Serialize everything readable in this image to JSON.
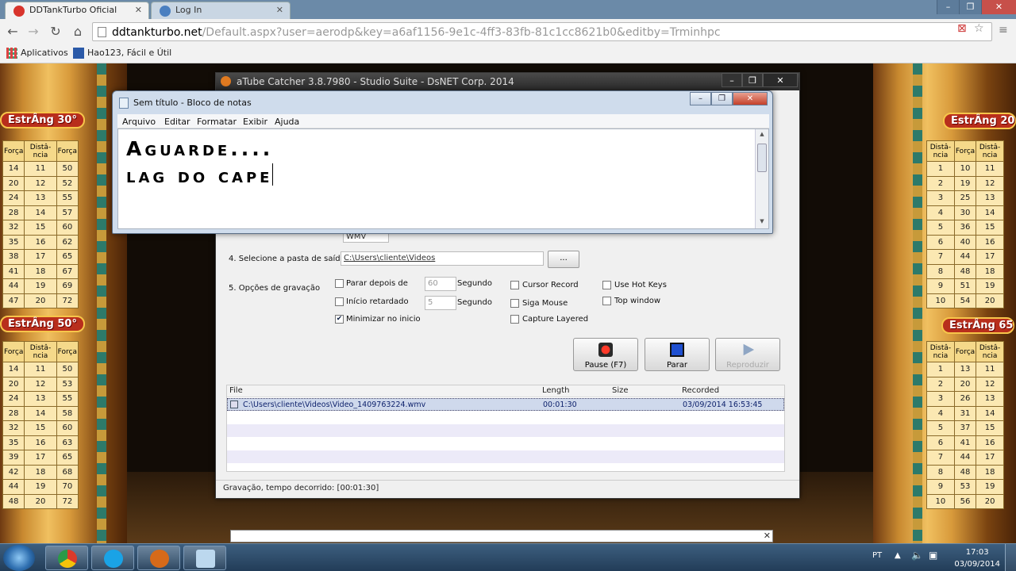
{
  "browser": {
    "tabs": [
      {
        "title": "DDTankTurbo Oficial",
        "active": true
      },
      {
        "title": "Log In",
        "active": false
      }
    ],
    "url_host": "ddtankturbo.net",
    "url_path": "/Default.aspx?user=aerodp&key=a6af1156-9e1c-4ff3-83fb-81c1cc8621b0&editby=Trminhpc",
    "bookmarks": [
      {
        "label": "Aplicativos"
      },
      {
        "label": "Hao123, Fácil e Útil"
      }
    ],
    "icons": {
      "back": "back-arrow-icon",
      "forward": "forward-arrow-icon",
      "reload": "reload-icon",
      "home": "home-icon",
      "star": "star-icon",
      "menu": "hamburger-menu-icon"
    }
  },
  "game": {
    "left_tables": [
      {
        "title": "EstrÂng 30°",
        "headers": [
          "Força",
          "Distâ-ncia",
          "Força"
        ],
        "rows": [
          [
            "14",
            "11",
            "50"
          ],
          [
            "20",
            "12",
            "52"
          ],
          [
            "24",
            "13",
            "55"
          ],
          [
            "28",
            "14",
            "57"
          ],
          [
            "32",
            "15",
            "60"
          ],
          [
            "35",
            "16",
            "62"
          ],
          [
            "38",
            "17",
            "65"
          ],
          [
            "41",
            "18",
            "67"
          ],
          [
            "44",
            "19",
            "69"
          ],
          [
            "47",
            "20",
            "72"
          ]
        ]
      },
      {
        "title": "EstrÂng 50°",
        "headers": [
          "Força",
          "Distâ-ncia",
          "Força"
        ],
        "rows": [
          [
            "14",
            "11",
            "50"
          ],
          [
            "20",
            "12",
            "53"
          ],
          [
            "24",
            "13",
            "55"
          ],
          [
            "28",
            "14",
            "58"
          ],
          [
            "32",
            "15",
            "60"
          ],
          [
            "35",
            "16",
            "63"
          ],
          [
            "39",
            "17",
            "65"
          ],
          [
            "42",
            "18",
            "68"
          ],
          [
            "44",
            "19",
            "70"
          ],
          [
            "48",
            "20",
            "72"
          ]
        ]
      }
    ],
    "right_tables": [
      {
        "title": "EstrÂng 20",
        "headers": [
          "Distâ-ncia",
          "Força",
          "Distâ-ncia"
        ],
        "rows": [
          [
            "1",
            "10",
            "11"
          ],
          [
            "2",
            "19",
            "12"
          ],
          [
            "3",
            "25",
            "13"
          ],
          [
            "4",
            "30",
            "14"
          ],
          [
            "5",
            "36",
            "15"
          ],
          [
            "6",
            "40",
            "16"
          ],
          [
            "7",
            "44",
            "17"
          ],
          [
            "8",
            "48",
            "18"
          ],
          [
            "9",
            "51",
            "19"
          ],
          [
            "10",
            "54",
            "20"
          ]
        ]
      },
      {
        "title": "EstrÂng 65",
        "headers": [
          "Distâ-ncia",
          "Força",
          "Distâ-ncia"
        ],
        "rows": [
          [
            "1",
            "13",
            "11"
          ],
          [
            "2",
            "20",
            "12"
          ],
          [
            "3",
            "26",
            "13"
          ],
          [
            "4",
            "31",
            "14"
          ],
          [
            "5",
            "37",
            "15"
          ],
          [
            "6",
            "41",
            "16"
          ],
          [
            "7",
            "44",
            "17"
          ],
          [
            "8",
            "48",
            "18"
          ],
          [
            "9",
            "53",
            "19"
          ],
          [
            "10",
            "56",
            "20"
          ]
        ]
      }
    ]
  },
  "atube": {
    "title": "aTube Catcher 3.8.7980 - Studio Suite - DsNET Corp. 2014",
    "hidden_format": "WMV",
    "output_folder_label": "4. Selecione a pasta de saída",
    "output_folder_value": "C:\\Users\\cliente\\Videos",
    "browse_label": "...",
    "options_label": "5. Opções de gravação",
    "options": {
      "stop_after": {
        "label": "Parar depois de",
        "checked": false,
        "value": "60",
        "unit": "Segundo"
      },
      "delayed_start": {
        "label": "Início retardado",
        "checked": false,
        "value": "5",
        "unit": "Segundo"
      },
      "minimize": {
        "label": "Minimizar no inicio",
        "checked": true
      },
      "cursor_record": {
        "label": "Cursor Record",
        "checked": false
      },
      "follow_mouse": {
        "label": "Siga Mouse",
        "checked": false
      },
      "capture_layered": {
        "label": "Capture Layered",
        "checked": false
      },
      "hot_keys": {
        "label": "Use Hot Keys",
        "checked": false
      },
      "top_window": {
        "label": "Top window",
        "checked": false
      }
    },
    "buttons": {
      "pause": "Pause (F7)",
      "stop": "Parar",
      "play": "Reproduzir"
    },
    "list": {
      "headers": {
        "file": "File",
        "length": "Length",
        "size": "Size",
        "recorded": "Recorded"
      },
      "rows": [
        {
          "file": "C:\\Users\\cliente\\Videos\\Video_1409763224.wmv",
          "length": "00:01:30",
          "size": "",
          "recorded": "03/09/2014 16:53:45"
        }
      ]
    },
    "status": "Gravação, tempo decorrido: [00:01:30]"
  },
  "notepad": {
    "title": "Sem título - Bloco de notas",
    "menu": [
      "Arquivo",
      "Editar",
      "Formatar",
      "Exibir",
      "Ajuda"
    ],
    "text_line1": "Aguarde....",
    "text_line2": "lag do cape"
  },
  "taskbar": {
    "apps": [
      {
        "name": "chrome-icon"
      },
      {
        "name": "skype-icon"
      },
      {
        "name": "atube-catcher-icon"
      },
      {
        "name": "notepad-icon"
      }
    ],
    "language": "PT",
    "time": "17:03",
    "date": "03/09/2014"
  },
  "colors": {
    "angle_title_bg": "#b82e1c",
    "table_bg": "#fbe8b2",
    "atube_title": "#2a2a2a",
    "taskbar": "#2a4a6a"
  }
}
